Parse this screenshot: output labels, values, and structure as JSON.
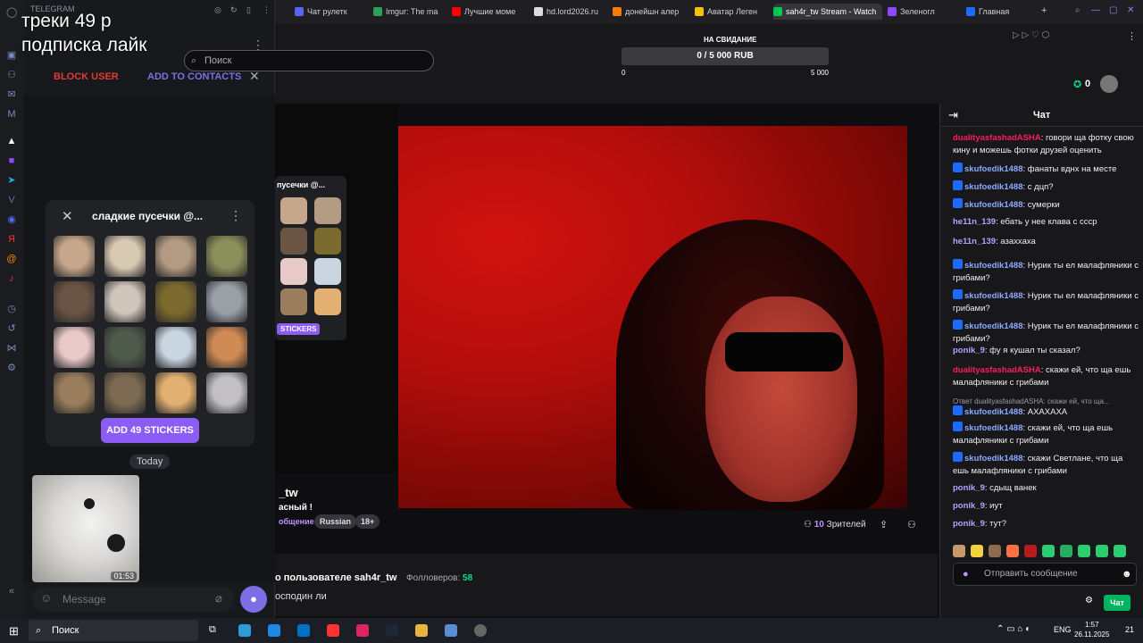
{
  "overlay": {
    "line1": "треки 49 р",
    "line2": "подписка лайк"
  },
  "telegram": {
    "brand": "TELEGRAM",
    "block_user": "BLOCK USER",
    "add_to_contacts": "ADD TO CONTACTS",
    "sticker_set_title": "сладкие пусечки @...",
    "add_stickers": "ADD 49 STICKERS",
    "date_divider": "Today",
    "video_time": "01:53",
    "message_placeholder": "Message"
  },
  "browser": {
    "tabs": [
      {
        "label": "Чат рулетк",
        "color": "#5865f2"
      },
      {
        "label": "Imgur: The ma",
        "color": "#2e9e5b"
      },
      {
        "label": "Лучшие моме",
        "color": "#ff0000"
      },
      {
        "label": "hd.lord2026.ru",
        "color": "#dddddd"
      },
      {
        "label": "донейшн алер",
        "color": "#f57d07"
      },
      {
        "label": "Аватар Леген",
        "color": "#f4c20d"
      },
      {
        "label": "sah4r_tw Stream - Watch",
        "color": "#00c853"
      },
      {
        "label": "Зеленогл",
        "color": "#9146ff"
      },
      {
        "label": "Главная",
        "color": "#1e69ff"
      }
    ]
  },
  "twitch": {
    "search_placeholder": "Поиск",
    "goal_label": "НА СВИДАНИЕ",
    "goal_progress": "0 / 5 000 RUB",
    "goal_fraction": 0,
    "goal_min": "0",
    "goal_max": "5 000",
    "bits": "0",
    "channel_name": "_tw",
    "stream_title": "асный !",
    "category": "общение",
    "tags": [
      "Russian",
      "18+"
    ],
    "viewers_count": "10",
    "viewers_label": "Зрителей",
    "about_title": "о пользователе sah4r_tw",
    "followers_label": "Фолловеров:",
    "followers_count": "58",
    "about_desc": "осподин ли",
    "mini_panel_title": "пусечки @...",
    "mini_panel_button": "STICKERS"
  },
  "chat": {
    "title": "Чат",
    "messages": [
      {
        "user": "dualityasfashadASHA",
        "color": "#ff1c5c",
        "badge": false,
        "text": "говори ща фотку свою кину и можешь фотки друзей оценить"
      },
      {
        "user": "skufoedik1488",
        "color": "#8fa8ff",
        "badge": true,
        "text": "фанаты вднх на месте"
      },
      {
        "user": "skufoedik1488",
        "color": "#8fa8ff",
        "badge": true,
        "text": "с дцп?"
      },
      {
        "user": "skufoedik1488",
        "color": "#8fa8ff",
        "badge": true,
        "text": "сумерки"
      },
      {
        "user": "he11n_139",
        "color": "#b7a1ff",
        "badge": false,
        "text": "ебать у нее клава с ссср"
      },
      {
        "user": "he11n_139",
        "color": "#b7a1ff",
        "badge": false,
        "text": "азаххаха"
      },
      {
        "user": "skufoedik1488",
        "color": "#8fa8ff",
        "badge": true,
        "text": "Нурик ты ел малафляники с грибами?"
      },
      {
        "user": "skufoedik1488",
        "color": "#8fa8ff",
        "badge": true,
        "text": "Нурик ты ел малафляники с грибами?"
      },
      {
        "user": "skufoedik1488",
        "color": "#8fa8ff",
        "badge": true,
        "text": "Нурик ты ел малафляники с грибами?"
      },
      {
        "user": "ponik_9",
        "color": "#b7a1ff",
        "badge": false,
        "text": "фу я кушал ты сказал?"
      },
      {
        "user": "dualityasfashadASHA",
        "color": "#ff1c5c",
        "badge": false,
        "text": "скажи ей, что ща ешь малафляники с грибами"
      },
      {
        "user": "skufoedik1488",
        "color": "#8fa8ff",
        "badge": true,
        "text": "АХАХАХА"
      },
      {
        "user": "skufoedik1488",
        "color": "#8fa8ff",
        "badge": true,
        "text": "скажи ей, что ща ешь малафляники с грибами"
      },
      {
        "user": "skufoedik1488",
        "color": "#8fa8ff",
        "badge": true,
        "text": "скажи Светлане, что ща ешь малафляники с грибами"
      },
      {
        "user": "ponik_9",
        "color": "#b7a1ff",
        "badge": false,
        "text": "сдыщ ванек"
      },
      {
        "user": "ponik_9",
        "color": "#b7a1ff",
        "badge": false,
        "text": "иут"
      },
      {
        "user": "ponik_9",
        "color": "#b7a1ff",
        "badge": false,
        "text": "тут?"
      }
    ],
    "reply_hint": "Ответ dualityasfashadASHA: скажи ей, что ща...",
    "input_placeholder": "Отправить сообщение",
    "send_button": "Чат"
  },
  "taskbar": {
    "search": "Поиск",
    "lang": "ENG",
    "time": "1:57",
    "date": "26.11.2025",
    "notifications": "21"
  }
}
